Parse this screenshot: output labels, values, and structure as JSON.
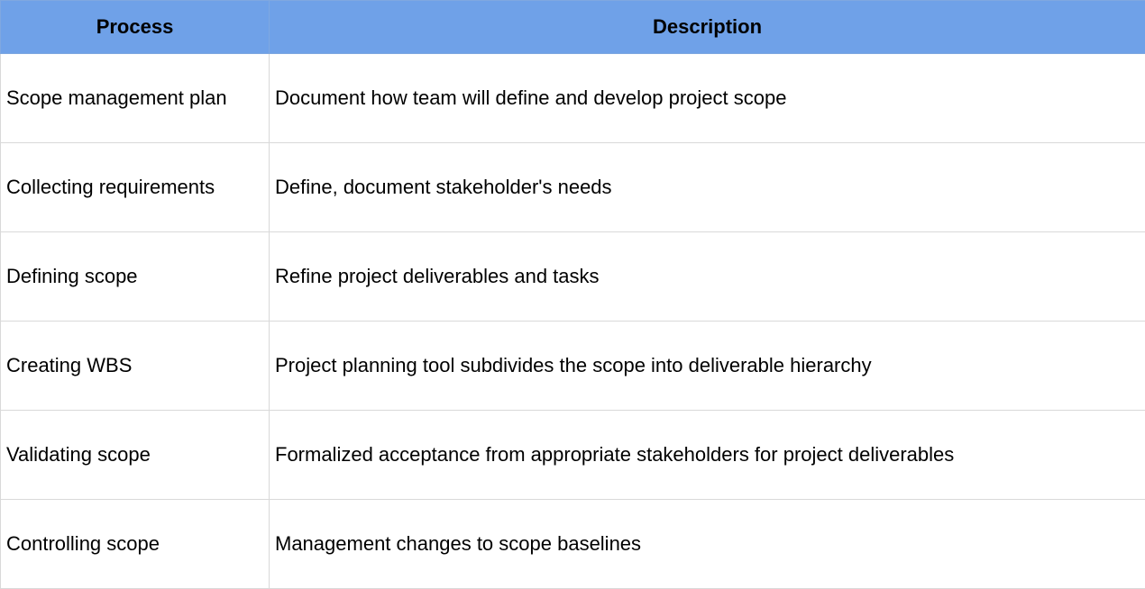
{
  "table": {
    "headers": {
      "process": "Process",
      "description": "Description"
    },
    "rows": [
      {
        "process": "Scope management plan",
        "description": "Document how team will define and develop project scope"
      },
      {
        "process": "Collecting requirements",
        "description": "Define, document stakeholder's needs"
      },
      {
        "process": "Defining scope",
        "description": "Refine project deliverables and tasks"
      },
      {
        "process": "Creating WBS",
        "description": "Project planning tool subdivides the scope into deliverable hierarchy"
      },
      {
        "process": "Validating scope",
        "description": "Formalized acceptance from appropriate stakeholders for project deliverables"
      },
      {
        "process": "Controlling scope",
        "description": "Management changes to scope baselines"
      }
    ]
  },
  "colors": {
    "header_background": "#6fa1e8",
    "grid_line": "#d9d9d9"
  }
}
